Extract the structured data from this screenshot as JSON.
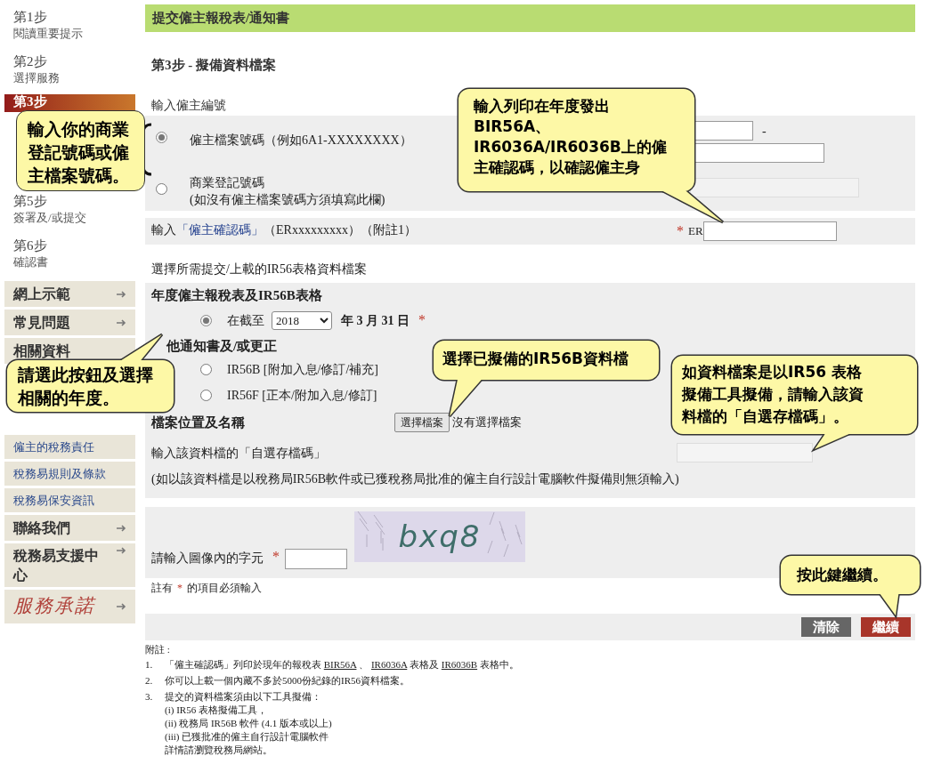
{
  "sidebar": {
    "steps_upper": [
      {
        "title": "第1步",
        "subtitle": "閱讀重要提示",
        "selected": false
      },
      {
        "title": "第2步",
        "subtitle": "選擇服務",
        "selected": false
      },
      {
        "title": "第3步",
        "selected": true
      }
    ],
    "steps_lower": [
      {
        "title": "第5步",
        "subtitle": "簽署及/或提交",
        "selected": false
      },
      {
        "title": "第6步",
        "subtitle": "確認書",
        "selected": false
      }
    ],
    "menu_upper": [
      {
        "label": "網上示範",
        "kind": "section",
        "arrow": true
      },
      {
        "label": "常見問題",
        "kind": "section",
        "arrow": true
      },
      {
        "label": "相關資料",
        "kind": "section",
        "arrow": false
      }
    ],
    "menu_lower": [
      {
        "label": "僱主的稅務責任",
        "kind": "link",
        "arrow": false
      },
      {
        "label": "稅務易規則及條款",
        "kind": "link",
        "arrow": false
      },
      {
        "label": "稅務易保安資訊",
        "kind": "link",
        "arrow": false
      },
      {
        "label": "聯絡我們",
        "kind": "section",
        "arrow": true
      },
      {
        "label": "稅務易支援中心",
        "kind": "section",
        "arrow": true
      },
      {
        "label": "服務承諾",
        "kind": "logo",
        "arrow": true
      }
    ]
  },
  "header": "提交僱主報稅表/通知書",
  "step_title": "第3步 - 擬備資料檔案",
  "employer": {
    "label": "輸入僱主編號",
    "options": [
      {
        "label": "僱主檔案號碼（例如6A1-XXXXXXXX）",
        "selected": true
      },
      {
        "label": "商業登記號碼",
        "note": "(如沒有僱主檔案號碼方須填寫此欄)",
        "selected": false
      }
    ],
    "separator": "-"
  },
  "confirmation": {
    "before": "輸入",
    "link": "「僱主確認碼」",
    "after": "（ERxxxxxxxxx）（附註1）",
    "required": "*",
    "prefix": "ER"
  },
  "upload": {
    "label": "選擇所需提交/上載的IR56表格資料檔案",
    "annual_heading": "年度僱主報稅表及IR56B表格",
    "annual": {
      "selected": true,
      "prefix": "在截至",
      "year": "2018",
      "date": "年 3 月 31 日",
      "required": "*"
    },
    "other_heading": "他通知書及/或更正",
    "others": [
      {
        "label": "IR56B [附加入息/修訂/補充]",
        "selected": false
      },
      {
        "label": "IR56F [正本/附加入息/修訂]",
        "selected": false
      }
    ],
    "file_label": "檔案位置及名稱",
    "file_button": "選擇檔案",
    "file_status": "沒有選擇檔案",
    "code_label": "輸入該資料檔的「自選存檔碼」",
    "code_note": "(如以該資料檔是以稅務局IR56B軟件或已獲稅務局批准的僱主自行設計電腦軟件擬備則無須輸入)"
  },
  "captcha": {
    "label": "請輸入圖像內的字元",
    "required": "*",
    "image_text": "bxq8"
  },
  "required_note": {
    "before": "註有",
    "mark": "*",
    "after": "的項目必須輸入"
  },
  "buttons": [
    {
      "label": "清除",
      "kind": "clear"
    },
    {
      "label": "繼續",
      "kind": "continue"
    }
  ],
  "notes": {
    "title": "附註 :",
    "items": [
      {
        "number": "1.",
        "parts": [
          {
            "text": "「僱主確認碼」列印於現年的報稅表 ",
            "kind": "plain"
          },
          {
            "text": "BIR56A",
            "kind": "link"
          },
          {
            "text": " 、 ",
            "kind": "plain"
          },
          {
            "text": "IR6036A",
            "kind": "link"
          },
          {
            "text": " 表格及 ",
            "kind": "plain"
          },
          {
            "text": "IR6036B",
            "kind": "link"
          },
          {
            "text": " 表格中。",
            "kind": "plain"
          }
        ]
      },
      {
        "number": "2.",
        "parts": [
          {
            "text": "你可以上載一個內藏不多於5000份紀錄的IR56資料檔案。",
            "kind": "plain"
          }
        ]
      },
      {
        "number": "3.",
        "parts": [
          {
            "text": "提交的資料檔案須由以下工具擬備：",
            "kind": "plain"
          }
        ],
        "lines": [
          "(i) IR56 表格擬備工具，",
          "(ii) 稅務局 IR56B 軟件 (4.1 版本或以上)",
          "(iii) 已獲批准的僱主自行設計電腦軟件",
          "詳情請瀏覽稅務局網站。"
        ]
      }
    ]
  },
  "callouts": [
    {
      "lines": [
        "輸入你的商業",
        "登記號碼或僱",
        "主檔案號碼。"
      ]
    },
    {
      "lines": [
        "輸入列印在年度發出",
        "BIR56A、",
        "IR6036A/IR6036B上的僱",
        "主確認碼，以確認僱主身"
      ]
    },
    {
      "lines": [
        "請選此按鈕及選擇",
        "相關的年度。"
      ]
    },
    {
      "lines": [
        "選擇已擬備的IR56B資料檔"
      ]
    },
    {
      "lines": [
        "如資料檔案是以IR56 表格",
        "擬備工具擬備，請輸入該資",
        "料檔的「自選存檔碼」。"
      ]
    },
    {
      "lines": [
        "按此鍵繼續。"
      ]
    }
  ]
}
